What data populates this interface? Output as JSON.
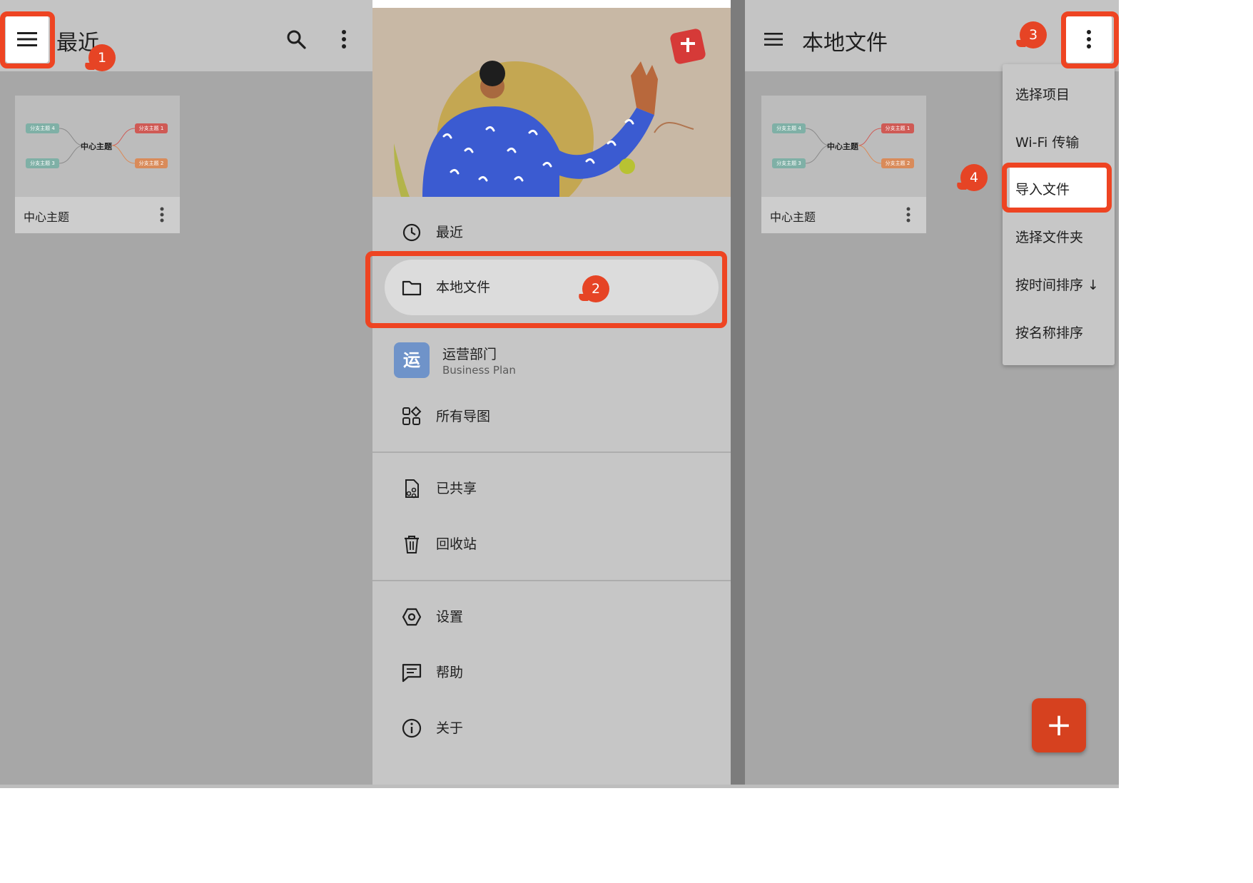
{
  "left_panel": {
    "title": "最近",
    "card": {
      "label": "中心主题",
      "thumbnail": {
        "center": "中心主题",
        "branches": [
          "分支主题 4",
          "分支主题 3",
          "分支主题 1",
          "分支主题 2"
        ]
      }
    }
  },
  "drawer": {
    "items": [
      {
        "label": "最近",
        "icon": "clock-icon"
      },
      {
        "label": "本地文件",
        "icon": "folder-icon",
        "selected": true
      },
      {
        "label": "运营部门",
        "sublabel": "Business Plan",
        "avatar_char": "运"
      },
      {
        "label": "所有导图",
        "icon": "grid-icon"
      },
      {
        "label": "已共享",
        "icon": "shared-file-icon"
      },
      {
        "label": "回收站",
        "icon": "trash-icon"
      },
      {
        "label": "设置",
        "icon": "settings-icon"
      },
      {
        "label": "帮助",
        "icon": "help-chat-icon"
      },
      {
        "label": "关于",
        "icon": "info-icon"
      }
    ]
  },
  "right_panel": {
    "title": "本地文件",
    "card": {
      "label": "中心主题",
      "thumbnail": {
        "center": "中心主题",
        "branches": [
          "分支主题 4",
          "分支主题 3",
          "分支主题 1",
          "分支主题 2"
        ]
      }
    },
    "menu": {
      "items": [
        "选择项目",
        "Wi-Fi 传输",
        "导入文件",
        "选择文件夹",
        "按时间排序 ↓",
        "按名称排序"
      ]
    },
    "fab_label": "+"
  },
  "annotations": {
    "steps": [
      "1",
      "2",
      "3",
      "4"
    ],
    "highlight_color": "#ee4422"
  },
  "colors": {
    "accent": "#d6411f",
    "branch_green": "#7fb0a6",
    "branch_red": "#cf5a55",
    "branch_orange": "#d98b5a"
  }
}
